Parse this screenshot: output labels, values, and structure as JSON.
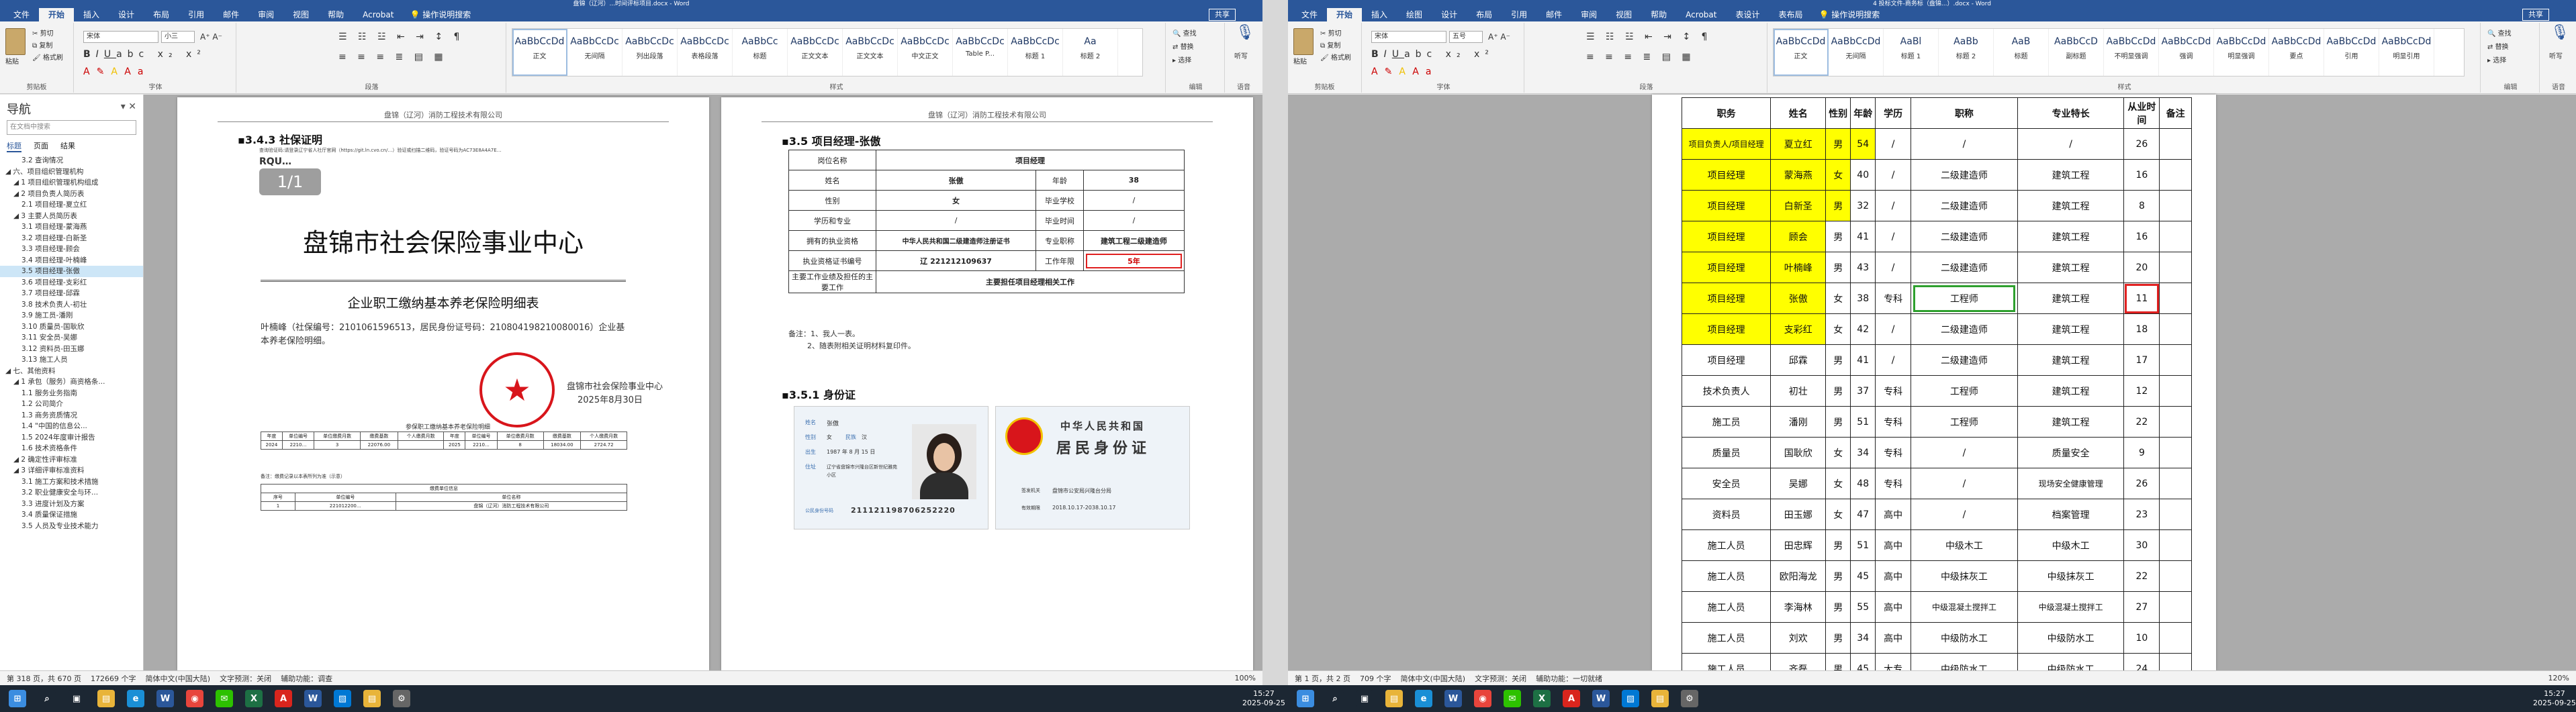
{
  "window_left": {
    "title": "盘锦（辽河）...时间评标项目.docx - Word",
    "tabs": [
      "文件",
      "开始",
      "插入",
      "设计",
      "布局",
      "引用",
      "邮件",
      "审阅",
      "视图",
      "帮助",
      "Acrobat"
    ],
    "tell_me": "操作说明搜索",
    "share": "共享",
    "ribbon": {
      "clipboard": {
        "paste": "粘贴",
        "cut": "剪切",
        "copy": "复制",
        "format_painter": "格式刷",
        "label": "剪贴板"
      },
      "font": {
        "name": "宋体",
        "size": "小三",
        "label": "字体"
      },
      "paragraph": {
        "label": "段落"
      },
      "styles": {
        "items": [
          {
            "preview": "AaBbCcDd",
            "name": "正文"
          },
          {
            "preview": "AaBbCcDc",
            "name": "无间隔"
          },
          {
            "preview": "AaBbCcDc",
            "name": "列出段落"
          },
          {
            "preview": "AaBbCcDc",
            "name": "表格段落"
          },
          {
            "preview": "AaBbCc",
            "name": "标题"
          },
          {
            "preview": "AaBbCcDc",
            "name": "正文文本"
          },
          {
            "preview": "AaBbCcDc",
            "name": "正文文本"
          },
          {
            "preview": "AaBbCcDc",
            "name": "中文正文"
          },
          {
            "preview": "AaBbCcDc",
            "name": "Table P..."
          },
          {
            "preview": "AaBbCcDc",
            "name": "标题 1"
          },
          {
            "preview": "Aa",
            "name": "标题 2"
          }
        ],
        "label": "样式"
      },
      "editing": {
        "find": "查找",
        "replace": "替换",
        "select": "选择",
        "label": "编辑"
      },
      "dictate": {
        "label": "听写",
        "group": "语音"
      }
    },
    "nav": {
      "title": "导航",
      "search_placeholder": "在文档中搜索",
      "tabs": [
        "标题",
        "页面",
        "结果"
      ],
      "items": [
        "3.2 查询情况",
        "六、项目组织管理机构",
        "1 项目组织管理机构组成",
        "2 项目负责人简历表",
        "2.1 项目经理-夏立红",
        "3 主要人员简历表",
        "3.1 项目经理-蒙海燕",
        "3.2 项目经理-白新圣",
        "3.3 项目经理-顾会",
        "3.4 项目经理-叶楠峰",
        "3.5 项目经理-张傲",
        "3.6 项目经理-支彩红",
        "3.7 项目经理-邱霖",
        "3.8 技术负责人-初壮",
        "3.9 施工员-潘刚",
        "3.10 质量员-国耿欣",
        "3.11 安全员-吴娜",
        "3.12 资料员-田玉娜",
        "3.13 施工人员",
        "七、其他资料",
        "1 承包（服务）商资格条...",
        "1.1 服务业务指南",
        "1.2 公司简介",
        "1.3 商务资质情况",
        "1.4 \"中国的信息公...",
        "1.5 2024年度审计报告",
        "1.6 技术资格条件",
        "2 确定性评审标准",
        "3 详细评审标准资料",
        "3.1 施工方案和技术措施",
        "3.2 职业健康安全与环...",
        "3.3 进度计划及方案",
        "3.4 质量保证措施",
        "3.5 人员及专业技术能力"
      ],
      "selected_index": 10
    },
    "page1": {
      "header": "盘锦（辽河）消防工程技术有限公司",
      "heading": "3.4.3 社保证明",
      "url_line": "查询验证码:请登录辽宁省人社厅官网（https://git.ln.cvo.cn/…）验证或扫描二维码，验证号码为AC73E8A4A7E…",
      "verify_code": "RQU…",
      "page_badge": "1/1",
      "org_title": "盘锦市社会保险事业中心",
      "doc_title": "企业职工缴纳基本养老保险明细表",
      "body_text": "叶楠峰（社保编号：2101061596513，居民身份证号码：210804198210080016）企业基本养老保险明细。",
      "stamp_org": "盘锦市社会保险事业中心",
      "stamp_date": "2025年8月30日",
      "table_caption": "参保职工缴纳基本养老保险明细",
      "table_headers": [
        "年度",
        "单位编号",
        "单位缴费月数",
        "缴费基数",
        "个人缴费月数",
        "年度",
        "单位编号",
        "单位缴费月数",
        "缴费基数",
        "个人缴费月数"
      ],
      "table_row": [
        "2024",
        "2210…",
        "3",
        "22076.00",
        "",
        "2025",
        "2210…",
        "8",
        "18034.00",
        "2724.72"
      ],
      "note_text": "备注：缴费记录以本表所列为准（示意）",
      "table2_title": "缴费单位信息",
      "table2_headers": [
        "序号",
        "单位编号",
        "单位名称"
      ],
      "table2_row": [
        "1",
        "221012200…",
        "盘锦（辽河）消防工程技术有限公司"
      ]
    },
    "page2": {
      "header": "盘锦（辽河）消防工程技术有限公司",
      "heading": "3.5 项目经理-张傲",
      "table": {
        "post_label": "岗位名称",
        "post_value": "项目经理",
        "name_label": "姓名",
        "name_value": "张傲",
        "age_label": "年龄",
        "age_value": "38",
        "sex_label": "性别",
        "sex_value": "女",
        "school_label": "毕业学校",
        "school_value": "/",
        "major_label": "学历和专业",
        "major_value": "/",
        "grad_label": "毕业时间",
        "grad_value": "/",
        "cert_label": "拥有的执业资格",
        "cert_value": "中华人民共和国二级建造师注册证书",
        "title_label": "专业职称",
        "title_value": "建筑工程二级建造师",
        "certno_label": "执业资格证书编号",
        "certno_value": "辽 221212109637",
        "years_label": "工作年限",
        "years_value": "5年",
        "duty_label": "主要工作业绩及担任的主要工作",
        "duty_value": "主要担任项目经理相关工作"
      },
      "notes": [
        "备注：1、我人一表。",
        "2、随表附相关证明材料复印件。"
      ],
      "sub_heading": "3.5.1 身份证",
      "id_front": {
        "name_label": "姓名",
        "name": "张傲",
        "sex_label": "性别",
        "sex": "女",
        "ethnic_label": "民族",
        "ethnic": "汉",
        "birth_label": "出生",
        "birth": "1987 年 8 月 15 日",
        "addr_label": "住址",
        "addr": "辽宁省盘锦市兴隆台区新世纪雅苑小区",
        "id_label": "公民身份号码",
        "id_no": "211121198706252220"
      },
      "id_back": {
        "country": "中华人民共和国",
        "title": "居民身份证",
        "issuer_label": "签发机关",
        "issuer": "盘锦市公安局兴隆台分局",
        "valid_label": "有效期限",
        "valid": "2018.10.17-2038.10.17"
      }
    },
    "status": {
      "page": "第 318 页，共 670 页",
      "words": "172669 个字",
      "lang": "简体中文(中国大陆)",
      "predict": "文字预测：关闭",
      "access": "辅助功能：调查",
      "zoom": "100%"
    }
  },
  "window_right": {
    "title": "4 投标文件-商务标（盘锦...）.docx - Word",
    "tabs": [
      "文件",
      "开始",
      "插入",
      "绘图",
      "设计",
      "布局",
      "引用",
      "邮件",
      "审阅",
      "视图",
      "帮助",
      "Acrobat",
      "表设计",
      "表布局"
    ],
    "tell_me": "操作说明搜索",
    "share": "共享",
    "ribbon": {
      "clipboard": {
        "paste": "粘贴",
        "cut": "剪切",
        "copy": "复制",
        "format_painter": "格式刷",
        "label": "剪贴板"
      },
      "font": {
        "name": "宋体",
        "size": "五号",
        "label": "字体"
      },
      "paragraph": {
        "label": "段落"
      },
      "styles": {
        "items": [
          {
            "preview": "AaBbCcDd",
            "name": "正文"
          },
          {
            "preview": "AaBbCcDd",
            "name": "无间隔"
          },
          {
            "preview": "AaBl",
            "name": "标题 1"
          },
          {
            "preview": "AaBb",
            "name": "标题 2"
          },
          {
            "preview": "AaB",
            "name": "标题"
          },
          {
            "preview": "AaBbCcD",
            "name": "副标题"
          },
          {
            "preview": "AaBbCcDd",
            "name": "不明显强调"
          },
          {
            "preview": "AaBbCcDd",
            "name": "强调"
          },
          {
            "preview": "AaBbCcDd",
            "name": "明显强调"
          },
          {
            "preview": "AaBbCcDd",
            "name": "要点"
          },
          {
            "preview": "AaBbCcDd",
            "name": "引用"
          },
          {
            "preview": "AaBbCcDd",
            "name": "明显引用"
          }
        ],
        "label": "样式"
      },
      "editing": {
        "find": "查找",
        "replace": "替换",
        "select": "选择",
        "label": "编辑"
      },
      "dictate": {
        "label": "听写",
        "group": "语音"
      }
    },
    "roster": {
      "headers": [
        "职务",
        "姓名",
        "性别",
        "年龄",
        "学历",
        "职称",
        "专业特长",
        "从业时间",
        "备注"
      ],
      "rows": [
        {
          "cells": [
            "项目负责人/项目经理",
            "夏立红",
            "男",
            "54",
            "/",
            "/",
            "/",
            "26",
            ""
          ],
          "hl": [
            0,
            1,
            2,
            3
          ]
        },
        {
          "cells": [
            "项目经理",
            "蒙海燕",
            "女",
            "40",
            "/",
            "二级建造师",
            "建筑工程",
            "16",
            ""
          ],
          "hl": [
            0,
            1,
            2
          ]
        },
        {
          "cells": [
            "项目经理",
            "白新圣",
            "男",
            "32",
            "/",
            "二级建造师",
            "建筑工程",
            "8",
            ""
          ],
          "hl": [
            0,
            1,
            2
          ]
        },
        {
          "cells": [
            "项目经理",
            "顾会",
            "男",
            "41",
            "/",
            "二级建造师",
            "建筑工程",
            "16",
            ""
          ],
          "hl": [
            0,
            1
          ]
        },
        {
          "cells": [
            "项目经理",
            "叶楠峰",
            "男",
            "43",
            "/",
            "二级建造师",
            "建筑工程",
            "20",
            ""
          ],
          "hl": [
            0,
            1
          ]
        },
        {
          "cells": [
            "项目经理",
            "张傲",
            "女",
            "38",
            "专科",
            "工程师",
            "建筑工程",
            "11",
            ""
          ],
          "hl": [
            0,
            1
          ],
          "green": 5,
          "red": 7
        },
        {
          "cells": [
            "项目经理",
            "支彩红",
            "女",
            "42",
            "/",
            "二级建造师",
            "建筑工程",
            "18",
            ""
          ],
          "hl": [
            0,
            1
          ]
        },
        {
          "cells": [
            "项目经理",
            "邱霖",
            "男",
            "41",
            "/",
            "二级建造师",
            "建筑工程",
            "17",
            ""
          ],
          "hl": []
        },
        {
          "cells": [
            "技术负责人",
            "初壮",
            "男",
            "37",
            "专科",
            "工程师",
            "建筑工程",
            "12",
            ""
          ],
          "hl": []
        },
        {
          "cells": [
            "施工员",
            "潘刚",
            "男",
            "51",
            "专科",
            "工程师",
            "建筑工程",
            "22",
            ""
          ],
          "hl": []
        },
        {
          "cells": [
            "质量员",
            "国耿欣",
            "女",
            "34",
            "专科",
            "/",
            "质量安全",
            "9",
            ""
          ],
          "hl": []
        },
        {
          "cells": [
            "安全员",
            "吴娜",
            "女",
            "48",
            "专科",
            "/",
            "现场安全健康管理",
            "26",
            ""
          ],
          "hl": []
        },
        {
          "cells": [
            "资料员",
            "田玉娜",
            "女",
            "47",
            "高中",
            "/",
            "档案管理",
            "23",
            ""
          ],
          "hl": []
        },
        {
          "cells": [
            "施工人员",
            "田忠辉",
            "男",
            "51",
            "高中",
            "中级木工",
            "中级木工",
            "30",
            ""
          ],
          "hl": []
        },
        {
          "cells": [
            "施工人员",
            "欧阳海龙",
            "男",
            "45",
            "高中",
            "中级抹灰工",
            "中级抹灰工",
            "22",
            ""
          ],
          "hl": []
        },
        {
          "cells": [
            "施工人员",
            "李海林",
            "男",
            "55",
            "高中",
            "中级混凝土搅拌工",
            "中级混凝土搅拌工",
            "27",
            ""
          ],
          "hl": []
        },
        {
          "cells": [
            "施工人员",
            "刘欢",
            "男",
            "34",
            "高中",
            "中级防水工",
            "中级防水工",
            "10",
            ""
          ],
          "hl": []
        },
        {
          "cells": [
            "施工人员",
            "齐磊",
            "男",
            "45",
            "大专",
            "中级防水工",
            "中级防水工",
            "24",
            ""
          ],
          "hl": []
        }
      ]
    },
    "status": {
      "page": "第 1 页，共 2 页",
      "words": "709 个字",
      "lang": "简体中文(中国大陆)",
      "predict": "文字预测：关闭",
      "access": "辅助功能：一切就绪",
      "zoom": "120%"
    }
  },
  "taskbar": {
    "icons": [
      "windows-start",
      "search",
      "task-view",
      "file-explorer",
      "edge",
      "word",
      "chrome",
      "wechat",
      "excel",
      "acrobat",
      "word-2",
      "photos",
      "folder",
      "settings"
    ],
    "clock_left": {
      "time": "15:27",
      "date": "2025-09-25"
    },
    "clock_right": {
      "time": "15:27",
      "date": "2025-09-25"
    }
  },
  "colors": {
    "word_blue": "#2b579a",
    "highlight": "#ffff00",
    "red_box": "#e02020",
    "green_box": "#2ea02e",
    "stamp_red": "#d8151b"
  }
}
